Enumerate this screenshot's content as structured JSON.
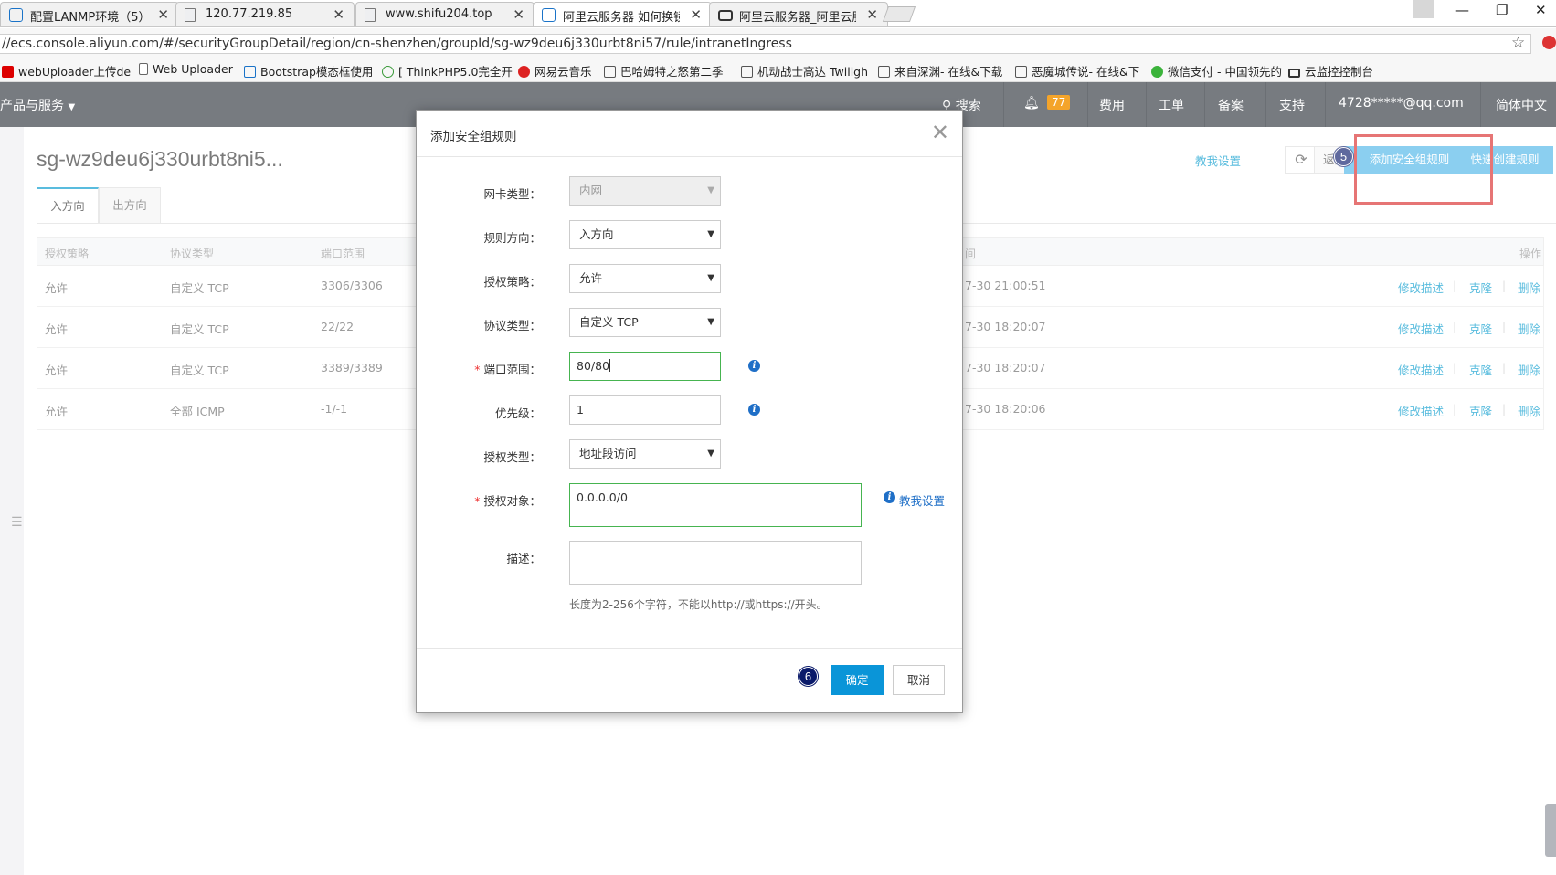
{
  "browser": {
    "tabs": [
      {
        "title": "配置LANMP环境（5）-"
      },
      {
        "title": "120.77.219.85"
      },
      {
        "title": "www.shifu204.top"
      },
      {
        "title": "阿里云服务器 如何换镜像"
      },
      {
        "title": "阿里云服务器_阿里云服务"
      }
    ],
    "url": "//ecs.console.aliyun.com/#/securityGroupDetail/region/cn-shenzhen/groupId/sg-wz9deu6j330urbt8ni57/rule/intranetIngress",
    "bookmarks": [
      {
        "label": "webUploader上传de"
      },
      {
        "label": "Web Uploader"
      },
      {
        "label": "Bootstrap模态框使用"
      },
      {
        "label": "[ ThinkPHP5.0完全开"
      },
      {
        "label": "网易云音乐"
      },
      {
        "label": "巴哈姆特之怒第二季"
      },
      {
        "label": "机动战士高达 Twiligh"
      },
      {
        "label": "来自深渊- 在线&下载"
      },
      {
        "label": "恶魔城传说- 在线&下"
      },
      {
        "label": "微信支付 - 中国领先的"
      },
      {
        "label": "云监控控制台"
      }
    ]
  },
  "console_nav": {
    "products_label": "产品与服务",
    "search_label": "搜索",
    "notification_count": "77",
    "items": [
      "费用",
      "工单",
      "备案",
      "支持"
    ],
    "account": "4728*****@qq.com",
    "language": "简体中文"
  },
  "page": {
    "title": "sg-wz9deu6j330urbt8ni5...",
    "tabs": [
      "入方向",
      "出方向"
    ],
    "teach_link": "教我设置",
    "back_label": "返回",
    "add_rule_label": "添加安全组规则",
    "quick_rule_label": "快速创建规则",
    "step5": "5",
    "table": {
      "headers": [
        "授权策略",
        "协议类型",
        "端口范围",
        "间",
        "操作"
      ],
      "rows": [
        {
          "policy": "允许",
          "protocol": "自定义 TCP",
          "ports": "3306/3306",
          "time": "7-30 21:00:51"
        },
        {
          "policy": "允许",
          "protocol": "自定义 TCP",
          "ports": "22/22",
          "time": "7-30 18:20:07"
        },
        {
          "policy": "允许",
          "protocol": "自定义 TCP",
          "ports": "3389/3389",
          "time": "7-30 18:20:07"
        },
        {
          "policy": "允许",
          "protocol": "全部 ICMP",
          "ports": "-1/-1",
          "time": "7-30 18:20:06"
        }
      ],
      "actions": [
        "修改描述",
        "克隆",
        "删除"
      ]
    }
  },
  "modal": {
    "title": "添加安全组规则",
    "fields": {
      "nic_type": {
        "label": "网卡类型：",
        "value": "内网"
      },
      "direction": {
        "label": "规则方向：",
        "value": "入方向"
      },
      "policy": {
        "label": "授权策略：",
        "value": "允许"
      },
      "protocol": {
        "label": "协议类型：",
        "value": "自定义 TCP"
      },
      "port_range": {
        "label": "端口范围：",
        "value": "80/80"
      },
      "priority": {
        "label": "优先级：",
        "value": "1"
      },
      "auth_type": {
        "label": "授权类型：",
        "value": "地址段访问"
      },
      "auth_object": {
        "label": "授权对象：",
        "value": "0.0.0.0/0"
      },
      "description": {
        "label": "描述：",
        "value": ""
      }
    },
    "teach_link": "教我设置",
    "description_hint": "长度为2-256个字符，不能以http://或https://开头。",
    "ok_label": "确定",
    "cancel_label": "取消",
    "step6": "6"
  },
  "colors": {
    "nav_bg": "#777b80",
    "primary_blue": "#0a95d8",
    "highlight_red": "#d92b2b",
    "valid_green": "#46b450"
  }
}
